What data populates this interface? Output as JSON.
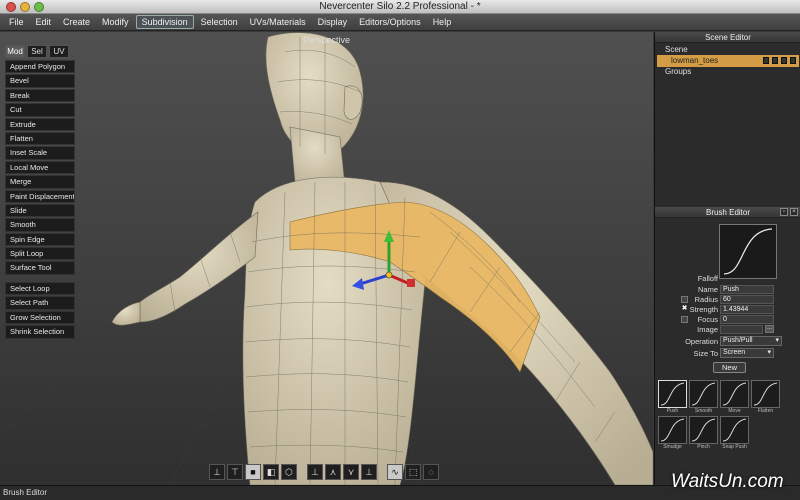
{
  "app": {
    "title": "Nevercenter Silo 2.2 Professional - *"
  },
  "menu": {
    "items": [
      "File",
      "Edit",
      "Create",
      "Modify",
      "Subdivision",
      "Selection",
      "UVs/Materials",
      "Display",
      "Editors/Options",
      "Help"
    ],
    "active": "Subdivision"
  },
  "viewport": {
    "label": "Perspective"
  },
  "tool_tabs": [
    "Mod",
    "Sel",
    "UV"
  ],
  "tools_modify": [
    "Append Polygon",
    "Bevel",
    "Break",
    "Cut",
    "Extrude",
    "Flatten",
    "Inset Scale",
    "Local Move",
    "Merge",
    "Paint Displacement",
    "Slide",
    "Smooth",
    "Spin Edge",
    "Split Loop",
    "Surface Tool"
  ],
  "tools_selection": [
    "Select Loop",
    "Select Path",
    "Grow Selection",
    "Shrink Selection"
  ],
  "scene_editor": {
    "header": "Scene Editor",
    "tree": {
      "scene": "Scene",
      "object": "lowman_toes",
      "groups": "Groups"
    }
  },
  "brush_editor": {
    "header": "Brush Editor",
    "falloff_label": "Falloff",
    "name_label": "Name",
    "name_value": "Push",
    "radius_label": "Radius",
    "radius_value": "60",
    "strength_label": "Strength",
    "strength_value": "1.43944",
    "focus_label": "Focus",
    "focus_value": "0",
    "image_label": "Image",
    "image_button": "...",
    "operation_label": "Operation",
    "operation_value": "Push/Pull",
    "sizeto_label": "Size To",
    "sizeto_value": "Screen",
    "new_button": "New",
    "presets": [
      {
        "label": "Push",
        "key": "A"
      },
      {
        "label": "Smooth",
        "key": "S"
      },
      {
        "label": "Move",
        "key": "D"
      },
      {
        "label": "Flatten",
        "key": "F"
      },
      {
        "label": "Smudge",
        "key": ""
      },
      {
        "label": "Pinch",
        "key": ""
      },
      {
        "label": "Snap Push",
        "key": ""
      }
    ]
  },
  "status": {
    "text": "Brush Editor"
  },
  "watermark": "WaitsUn.com",
  "colors": {
    "selection_orange": "#d49d45",
    "mesh_skin": "#d8cfb6",
    "highlight_faces": "#e8b865"
  }
}
